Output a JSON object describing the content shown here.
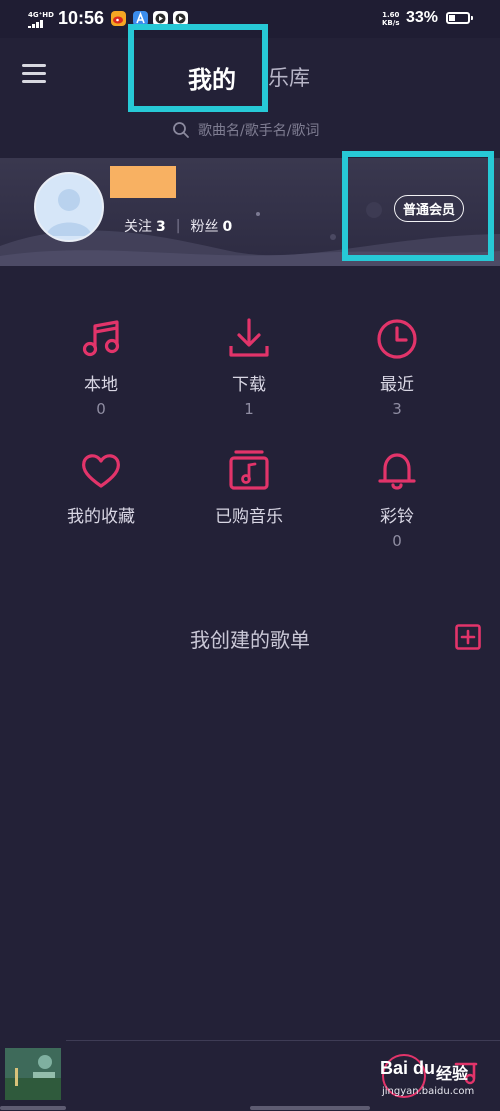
{
  "status_bar": {
    "network": "4G⁺HD",
    "time": "10:56",
    "speed_value": "1.60",
    "speed_unit": "KB/s",
    "battery": "33%"
  },
  "header": {
    "tabs": [
      {
        "label": "我的",
        "active": true
      },
      {
        "label": "乐库",
        "active": false,
        "visible_text": "乐库"
      }
    ],
    "search_placeholder": "歌曲名/歌手名/歌词"
  },
  "profile": {
    "follow_label": "关注",
    "follow_count": "3",
    "fans_label": "粉丝",
    "fans_count": "0",
    "member_badge": "普通会员"
  },
  "shortcuts": [
    {
      "label": "本地",
      "count": "0",
      "icon": "music-note-icon"
    },
    {
      "label": "下载",
      "count": "1",
      "icon": "download-icon"
    },
    {
      "label": "最近",
      "count": "3",
      "icon": "clock-icon"
    },
    {
      "label": "我的收藏",
      "count": "",
      "icon": "heart-icon"
    },
    {
      "label": "已购音乐",
      "count": "",
      "icon": "purchased-music-icon"
    },
    {
      "label": "彩铃",
      "count": "0",
      "icon": "bell-icon"
    }
  ],
  "playlists": {
    "title": "我创建的歌单"
  },
  "watermark": {
    "brand": "Bai du",
    "product": "经验",
    "url": "jingyan.baidu.com"
  },
  "colors": {
    "background": "#232137",
    "accent": "#e2346a",
    "highlight": "#27c9d6",
    "username_block": "#f8b162"
  }
}
